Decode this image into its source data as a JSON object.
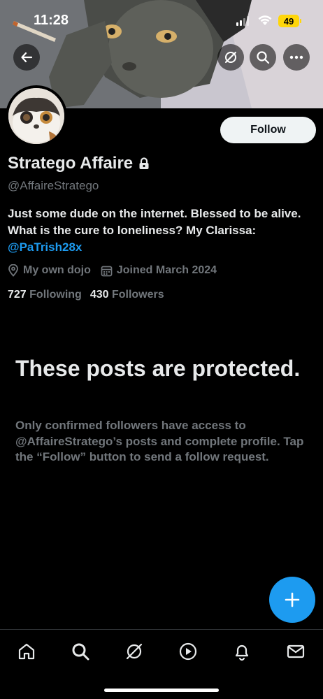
{
  "status_bar": {
    "time": "11:28",
    "battery": "49"
  },
  "profile": {
    "name": "Stratego Affaire",
    "handle": "@AffaireStratego",
    "bio_text": "Just some dude on the internet. Blessed to be alive. What is the cure to loneliness? My Clarissa: ",
    "bio_mention": "@PaTrish28x",
    "location": "My own dojo",
    "joined": "Joined March 2024",
    "following_count": "727",
    "following_label": "Following",
    "followers_count": "430",
    "followers_label": "Followers",
    "follow_button": "Follow"
  },
  "protected": {
    "title": "These posts are protected.",
    "message": "Only confirmed followers have access to @AffaireStratego’s posts and complete profile. Tap the “Follow” button to send a follow request."
  },
  "icons": {
    "back": "back-arrow-icon",
    "grok": "grok-icon",
    "search": "search-icon",
    "more": "more-icon",
    "lock": "lock-icon",
    "location": "location-pin-icon",
    "calendar": "calendar-icon",
    "compose": "plus-icon",
    "tabs": [
      "home-icon",
      "search-icon",
      "grok-icon",
      "play-icon",
      "bell-icon",
      "mail-icon"
    ]
  },
  "colors": {
    "accent": "#1d9bf0",
    "background": "#000000",
    "muted": "#71767b",
    "battery": "#ffd60a"
  }
}
